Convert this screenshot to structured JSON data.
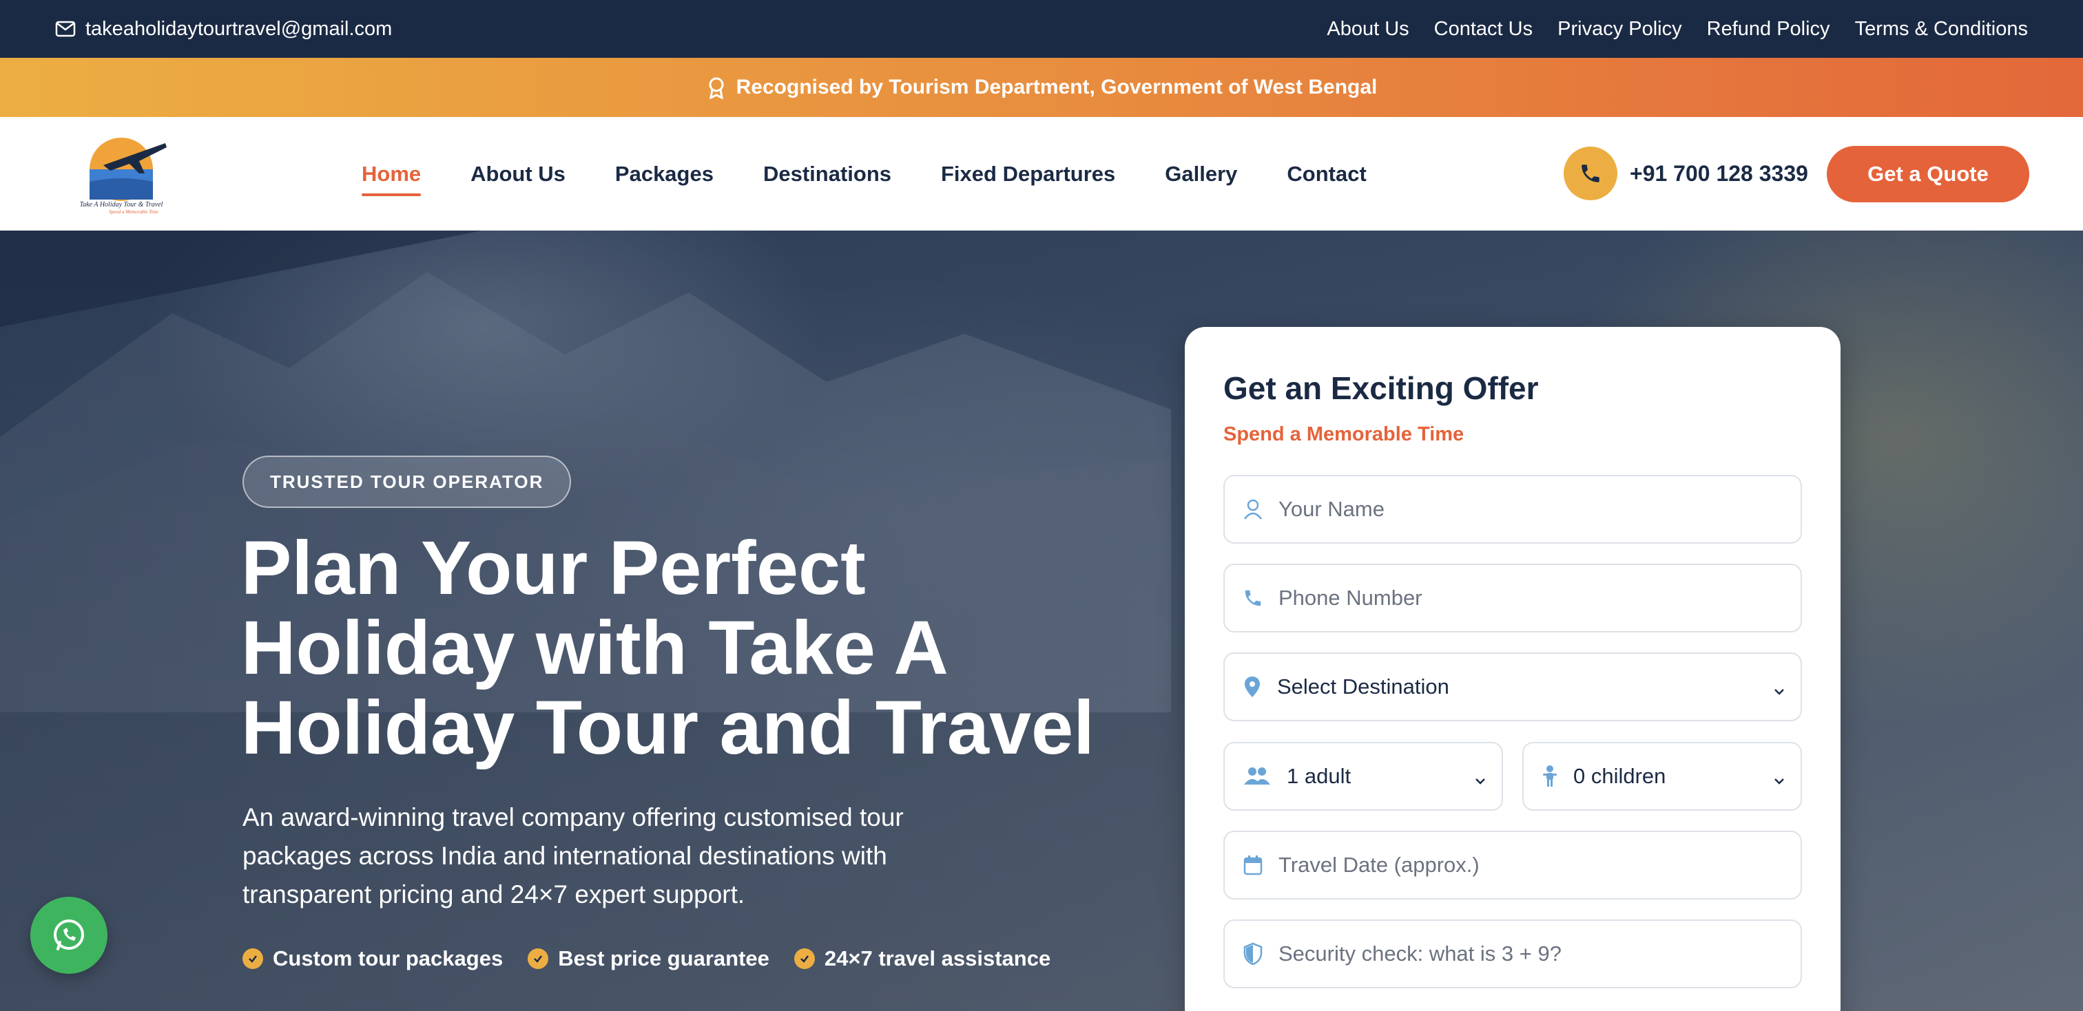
{
  "topbar": {
    "email": "takeaholidaytourtravel@gmail.com",
    "links": [
      "About Us",
      "Contact Us",
      "Privacy Policy",
      "Refund Policy",
      "Terms & Conditions"
    ]
  },
  "announcement": "Recognised by Tourism Department, Government of West Bengal",
  "header": {
    "logo_text_1": "Take A Holiday Tour & Travel",
    "logo_text_2": "Spend a Memorable Time",
    "nav": [
      "Home",
      "About Us",
      "Packages",
      "Destinations",
      "Fixed Departures",
      "Gallery",
      "Contact"
    ],
    "active_nav": "Home",
    "phone": "+91 700 128 3339",
    "quote_button": "Get a Quote"
  },
  "hero": {
    "badge": "TRUSTED TOUR OPERATOR",
    "headline_1": "Plan Your Perfect",
    "headline_2": "Holiday with Take A",
    "headline_3": "Holiday Tour and Travel",
    "subtext": "An award-winning travel company offering customised tour packages across India and international destinations with transparent pricing and 24×7 expert support.",
    "features": [
      "Custom tour packages",
      "Best price guarantee",
      "24×7 travel assistance"
    ]
  },
  "form": {
    "title": "Get an Exciting Offer",
    "subtitle": "Spend a Memorable Time",
    "name_placeholder": "Your Name",
    "phone_placeholder": "Phone Number",
    "destination_selected": "Select Destination",
    "adults_selected": "1 adult",
    "children_selected": "0 children",
    "date_placeholder": "Travel Date (approx.)",
    "security_placeholder": "Security check: what is 3 + 9?"
  },
  "colors": {
    "navy": "#1b2a44",
    "accent_orange": "#e5633a",
    "accent_gold": "#ecae42",
    "whatsapp_green": "#3fb45f"
  }
}
